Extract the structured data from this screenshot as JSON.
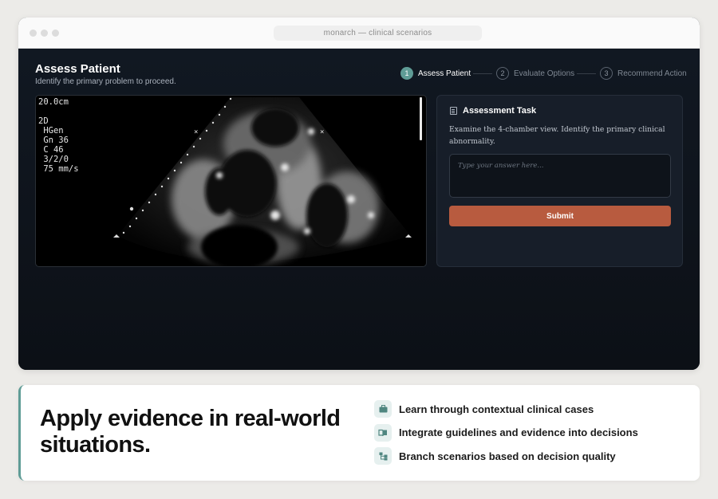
{
  "window": {
    "url_title": "monarch — clinical scenarios"
  },
  "header": {
    "title": "Assess Patient",
    "subtitle": "Identify the primary problem to proceed."
  },
  "stepper": {
    "steps": [
      {
        "num": "1",
        "label": "Assess Patient",
        "active": true
      },
      {
        "num": "2",
        "label": "Evaluate Options",
        "active": false
      },
      {
        "num": "3",
        "label": "Recommend Action",
        "active": false
      }
    ]
  },
  "echo": {
    "overlay_lines": [
      "20.0cm",
      "",
      "2D",
      " HGen",
      " Gn 36",
      " C 46",
      " 3/2/0",
      " 75 mm/s"
    ]
  },
  "task": {
    "title": "Assessment Task",
    "description": "Examine the 4-chamber view. Identify the primary clinical abnormality.",
    "answer_placeholder": "Type your answer here...",
    "answer_value": "",
    "submit_label": "Submit"
  },
  "card": {
    "headline": "Apply evidence in real-world situations.",
    "features": [
      {
        "icon": "briefcase-icon",
        "label": "Learn through contextual clinical cases"
      },
      {
        "icon": "book-icon",
        "label": "Integrate guidelines and evidence into decisions"
      },
      {
        "icon": "branch-icon",
        "label": "Branch scenarios based on decision quality"
      }
    ]
  },
  "colors": {
    "accent_teal": "#5f9c96",
    "submit_orange": "#b85b3f",
    "app_bg": "#0e131a"
  }
}
